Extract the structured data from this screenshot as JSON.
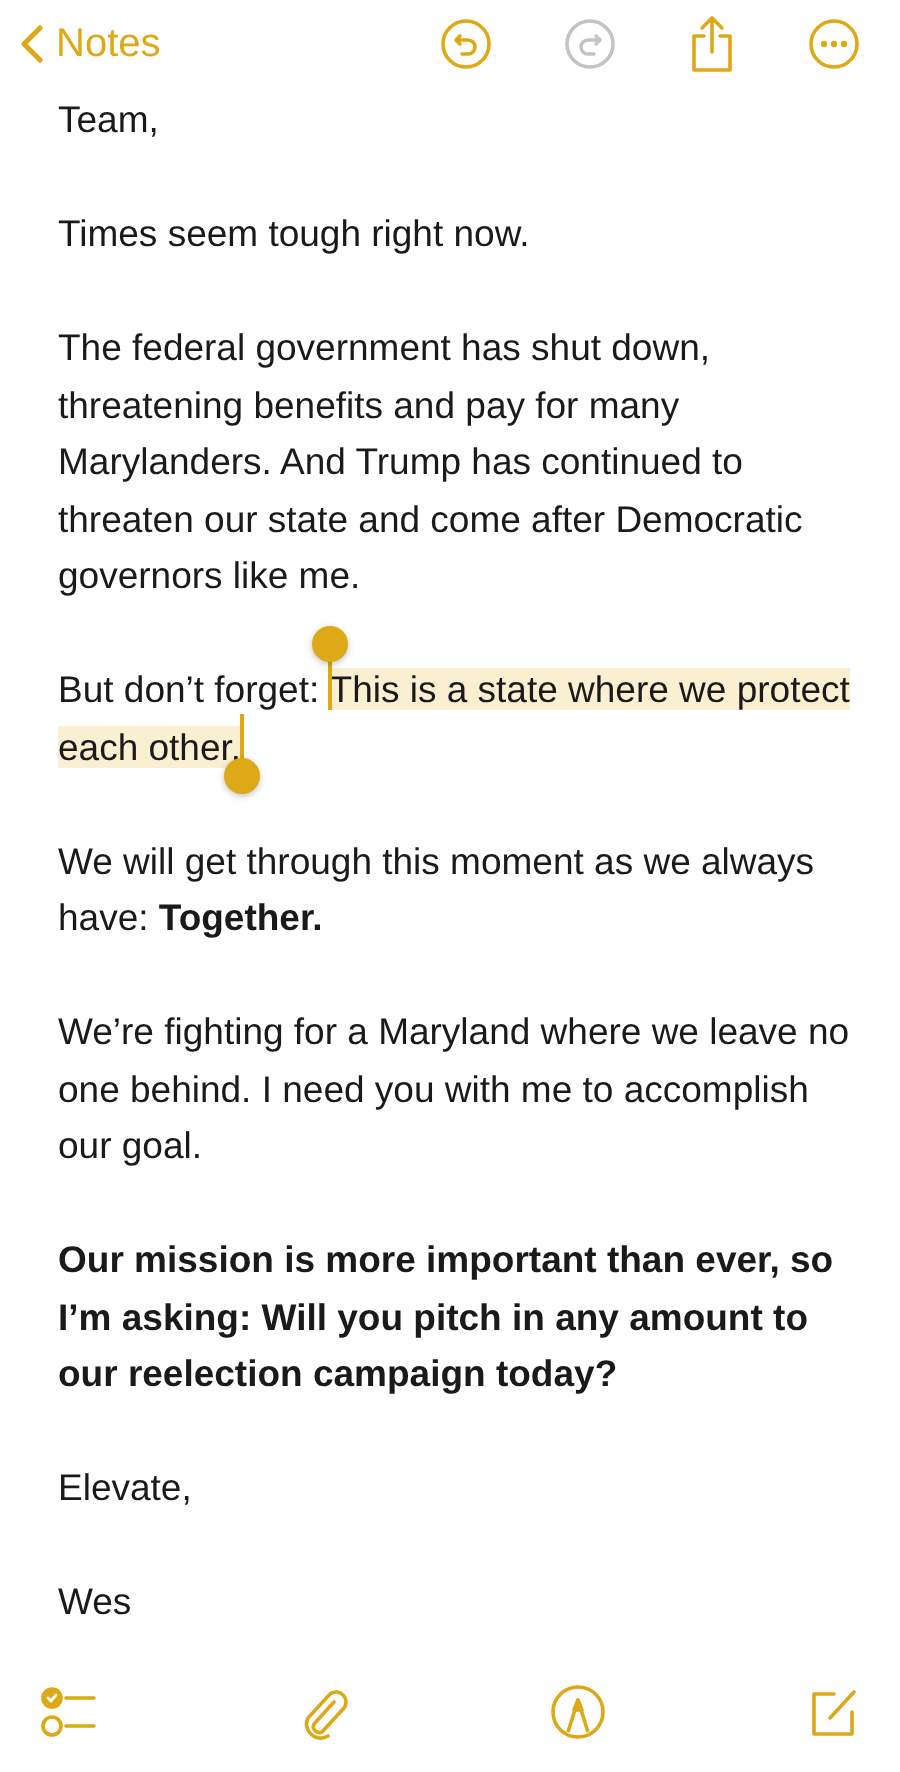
{
  "nav": {
    "back_label": "Notes",
    "buttons": [
      {
        "kind": "undo",
        "disabled": false
      },
      {
        "kind": "redo",
        "disabled": true
      },
      {
        "kind": "share",
        "disabled": false
      },
      {
        "kind": "more",
        "disabled": false
      }
    ]
  },
  "note": {
    "paragraphs": [
      {
        "bold": false,
        "segments": [
          {
            "text": "Team,",
            "selected": false
          }
        ]
      },
      {
        "bold": false,
        "segments": [
          {
            "text": "Times seem tough right now.",
            "selected": false
          }
        ]
      },
      {
        "bold": false,
        "segments": [
          {
            "text": "The federal government has shut down, threatening benefits and pay for many Marylanders. And Trump has continued to threaten our state and come after Democratic governors like me.",
            "selected": false
          }
        ]
      },
      {
        "bold": false,
        "segments": [
          {
            "text": "But don’t forget: ",
            "selected": false
          },
          {
            "text": "This is a state where we protect each other.",
            "selected": true
          }
        ]
      },
      {
        "bold": false,
        "segments": [
          {
            "text": "We will get through this moment as we always have: **Together.**",
            "selected": false
          }
        ]
      },
      {
        "bold": false,
        "segments": [
          {
            "text": "We’re fighting for a Maryland where we leave no one behind. I need you with me to accomplish our goal.",
            "selected": false
          }
        ]
      },
      {
        "bold": true,
        "segments": [
          {
            "text": "Our mission is more important than ever, so I’m asking: Will you pitch in any amount to our reelection campaign today?",
            "selected": false
          }
        ]
      },
      {
        "bold": false,
        "segments": [
          {
            "text": "Elevate,",
            "selected": false
          }
        ]
      },
      {
        "bold": false,
        "segments": [
          {
            "text": "Wes",
            "selected": false
          }
        ]
      }
    ]
  },
  "toolbar": [
    {
      "kind": "checklist"
    },
    {
      "kind": "attachment"
    },
    {
      "kind": "markup"
    },
    {
      "kind": "compose"
    }
  ]
}
